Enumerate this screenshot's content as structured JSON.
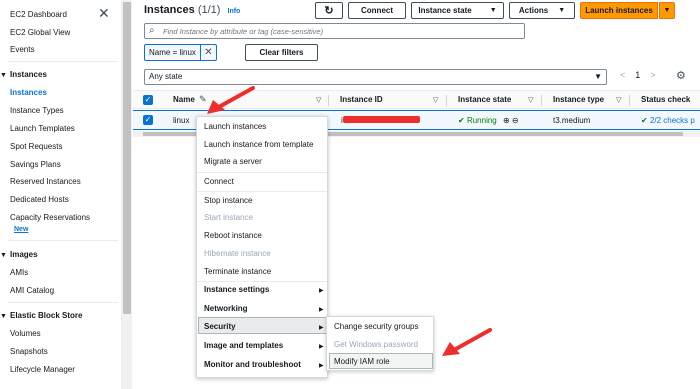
{
  "sidebar": {
    "top_items": [
      "EC2 Dashboard",
      "EC2 Global View",
      "Events"
    ],
    "instances_section": "Instances",
    "instances_items": [
      "Instances",
      "Instance Types",
      "Launch Templates",
      "Spot Requests",
      "Savings Plans",
      "Reserved Instances",
      "Dedicated Hosts",
      "Capacity Reservations"
    ],
    "new_badge": "New",
    "images_section": "Images",
    "images_items": [
      "AMIs",
      "AMI Catalog"
    ],
    "ebs_section": "Elastic Block Store",
    "ebs_items": [
      "Volumes",
      "Snapshots",
      "Lifecycle Manager"
    ]
  },
  "header": {
    "title": "Instances",
    "count": "(1/1)",
    "info": "Info",
    "connect": "Connect",
    "instance_state": "Instance state",
    "actions": "Actions",
    "launch": "Launch instances"
  },
  "search": {
    "placeholder": "Find Instance by attribute or tag (case-sensitive)"
  },
  "filter": {
    "chip": "Name = linux",
    "clear": "Clear filters"
  },
  "state_select": {
    "value": "Any state"
  },
  "pagination": {
    "prev": "<",
    "page": "1",
    "next": ">"
  },
  "table": {
    "columns": [
      "Name",
      "Instance ID",
      "Instance state",
      "Instance type",
      "Status check"
    ],
    "rows": [
      {
        "name": "linux",
        "instance_id": "i-",
        "state": "Running",
        "type": "t3.medium",
        "status": "2/2 checks p"
      }
    ]
  },
  "context_menu": {
    "items": [
      "Launch instances",
      "Launch instance from template",
      "Migrate a server",
      "Connect",
      "Stop instance",
      "Start instance",
      "Reboot instance",
      "Hibernate instance",
      "Terminate instance",
      "Instance settings",
      "Networking",
      "Security",
      "Image and templates",
      "Monitor and troubleshoot"
    ]
  },
  "submenu": {
    "items": [
      "Change security groups",
      "Get Windows password",
      "Modify IAM role"
    ]
  },
  "colors": {
    "accent": "#0972d3",
    "primary": "#ff9900",
    "running": "#037f0c",
    "annotation": "#ee2d2d"
  }
}
